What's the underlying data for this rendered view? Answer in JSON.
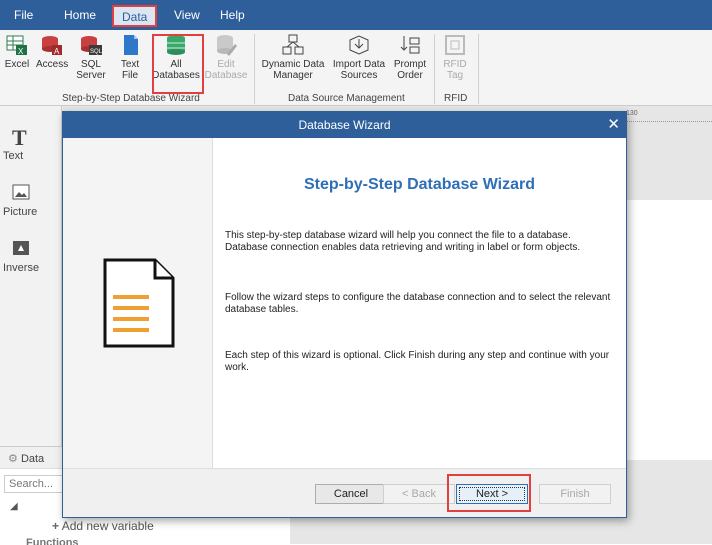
{
  "menu": {
    "file": "File",
    "home": "Home",
    "data": "Data",
    "view": "View",
    "help": "Help"
  },
  "ribbon": {
    "db_wizard_group": {
      "label": "Step-by-Step Database Wizard",
      "buttons": [
        {
          "line1": "Excel",
          "line2": "",
          "icon": "excel-icon"
        },
        {
          "line1": "Access",
          "line2": "",
          "icon": "access-icon"
        },
        {
          "line1": "SQL",
          "line2": "Server",
          "icon": "sql-server-icon"
        },
        {
          "line1": "Text",
          "line2": "File",
          "icon": "text-file-icon"
        },
        {
          "line1": "All",
          "line2": "Databases",
          "icon": "all-databases-icon"
        },
        {
          "line1": "Edit",
          "line2": "Database",
          "icon": "edit-database-icon"
        }
      ]
    },
    "data_source_group": {
      "label": "Data Source Management",
      "buttons": [
        {
          "line1": "Dynamic Data",
          "line2": "Manager",
          "icon": "dynamic-data-icon"
        },
        {
          "line1": "Import Data",
          "line2": "Sources",
          "icon": "import-data-icon"
        },
        {
          "line1": "Prompt",
          "line2": "Order",
          "icon": "prompt-order-icon"
        }
      ]
    },
    "rfid_group": {
      "label": "RFID",
      "buttons": [
        {
          "line1": "RFID",
          "line2": "Tag",
          "icon": "rfid-tag-icon"
        }
      ]
    }
  },
  "toolbox": {
    "text": "Text",
    "picture": "Picture",
    "inverse": "Inverse"
  },
  "ruler": {
    "mark": "130"
  },
  "data_panel": {
    "title": "Data",
    "search_placeholder": "Search...",
    "add_variable": "Add new variable",
    "functions": "Functions"
  },
  "dialog": {
    "title": "Database Wizard",
    "close": "✕",
    "heading": "Step-by-Step Database Wizard",
    "paragraphs": [
      "This step-by-step database wizard will help you connect the file to a database. Database connection enables data retrieving and writing in label or form objects.",
      "Follow the wizard steps to configure the database connection and to select the relevant database tables.",
      "Each step of this wizard is optional. Click Finish during any step and continue with your work."
    ],
    "buttons": {
      "cancel": "Cancel",
      "back": "< Back",
      "next": "Next >",
      "finish": "Finish"
    }
  },
  "colors": {
    "accent": "#2e5f9a",
    "highlight": "#e04040",
    "heading": "#2e6fb8",
    "doc_orange": "#f0a030"
  }
}
